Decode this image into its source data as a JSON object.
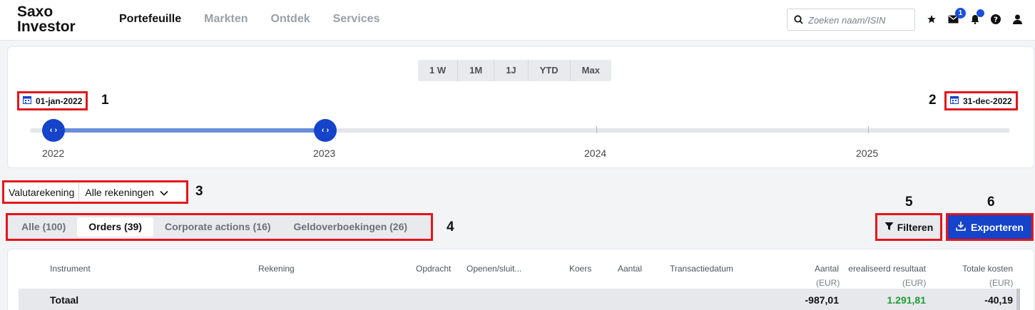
{
  "header": {
    "logo_line1": "Saxo",
    "logo_line2": "Investor",
    "nav": [
      {
        "label": "Portefeuille",
        "active": true
      },
      {
        "label": "Markten",
        "active": false
      },
      {
        "label": "Ontdek",
        "active": false
      },
      {
        "label": "Services",
        "active": false
      }
    ],
    "search_placeholder": "Zoeken naam/ISIN",
    "icons": [
      "star-icon",
      "mail-icon",
      "bell-icon",
      "help-icon",
      "user-icon"
    ],
    "mail_badge": "1"
  },
  "timeline": {
    "periods": [
      "1 W",
      "1M",
      "1J",
      "YTD",
      "Max"
    ],
    "start_date": "01-jan-2022",
    "end_date": "31-dec-2022",
    "years": [
      "2022",
      "2023",
      "2024",
      "2025"
    ]
  },
  "annotations": [
    "1",
    "2",
    "3",
    "4",
    "5",
    "6"
  ],
  "account": {
    "label": "Valutarekening",
    "selected": "Alle rekeningen"
  },
  "tabs": [
    {
      "label": "Alle (100)",
      "active": false
    },
    {
      "label": "Orders (39)",
      "active": true
    },
    {
      "label": "Corporate actions (16)",
      "active": false
    },
    {
      "label": "Geldoverboekingen (26)",
      "active": false
    }
  ],
  "actions": {
    "filter_label": "Filteren",
    "export_label": "Exporteren"
  },
  "table": {
    "columns": [
      "Instrument",
      "Rekening",
      "Opdracht",
      "Openen/sluit...",
      "Koers",
      "Aantal",
      "Transactiedatum",
      "Aantal",
      "erealiseerd resultaat",
      "Totale kosten"
    ],
    "units": [
      "(EUR)",
      "(EUR)",
      "(EUR)"
    ],
    "total": {
      "label": "Totaal",
      "amount": "-987,01",
      "realized": "1.291,81",
      "costs": "-40,19"
    }
  },
  "colors": {
    "brand_blue": "#1543c9",
    "highlight_red": "#e3161c",
    "positive_green": "#1f9d3a"
  }
}
